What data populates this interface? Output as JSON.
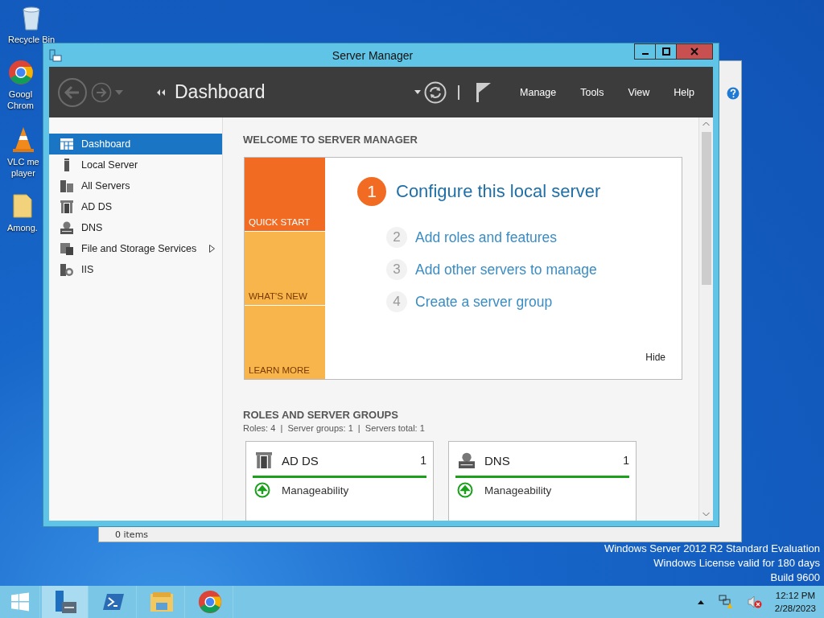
{
  "desktop": {
    "icons": [
      {
        "kind": "bin",
        "lines": [
          "Recycle Bin"
        ]
      },
      {
        "kind": "chrome",
        "lines": [
          "Googl",
          "Chrom"
        ]
      },
      {
        "kind": "vlc",
        "lines": [
          "VLC me",
          "player"
        ]
      },
      {
        "kind": "folder",
        "lines": [
          "Among."
        ]
      }
    ],
    "watermark": [
      "Windows Server 2012 R2 Standard Evaluation",
      "Windows License valid for 180 days",
      "Build 9600"
    ]
  },
  "back_window": {
    "status": "0 items"
  },
  "window": {
    "title": "Server Manager",
    "breadcrumb": "Dashboard",
    "menu": [
      "Manage",
      "Tools",
      "View",
      "Help"
    ],
    "sidebar": [
      {
        "kind": "dashboard",
        "label": "Dashboard",
        "selected": true,
        "submenu": false
      },
      {
        "kind": "server",
        "label": "Local Server",
        "selected": false,
        "submenu": false
      },
      {
        "kind": "servers",
        "label": "All Servers",
        "selected": false,
        "submenu": false
      },
      {
        "kind": "adds",
        "label": "AD DS",
        "selected": false,
        "submenu": false
      },
      {
        "kind": "dns",
        "label": "DNS",
        "selected": false,
        "submenu": false
      },
      {
        "kind": "storage",
        "label": "File and Storage Services",
        "selected": false,
        "submenu": true
      },
      {
        "kind": "iis",
        "label": "IIS",
        "selected": false,
        "submenu": false
      }
    ],
    "welcome": {
      "heading": "WELCOME TO SERVER MANAGER",
      "tiles": [
        {
          "label": "QUICK START",
          "selected": true
        },
        {
          "label": "WHAT'S NEW",
          "selected": false
        },
        {
          "label": "LEARN MORE",
          "selected": false
        }
      ],
      "steps": [
        {
          "number": "1",
          "label": "Configure this local server",
          "primary": true
        },
        {
          "number": "2",
          "label": "Add roles and features",
          "primary": false
        },
        {
          "number": "3",
          "label": "Add other servers to manage",
          "primary": false
        },
        {
          "number": "4",
          "label": "Create a server group",
          "primary": false
        }
      ],
      "hide": "Hide"
    },
    "roles": {
      "heading": "ROLES AND SERVER GROUPS",
      "stats": "Roles: 4  |  Server groups: 1  |  Servers total: 1",
      "cards": [
        {
          "kind": "adds",
          "title": "AD DS",
          "count": "1",
          "status": "Manageability"
        },
        {
          "kind": "dns",
          "title": "DNS",
          "count": "1",
          "status": "Manageability"
        }
      ]
    }
  },
  "taskbar": {
    "apps": [
      {
        "kind": "server-manager",
        "selected": true
      },
      {
        "kind": "powershell",
        "selected": false
      },
      {
        "kind": "explorer",
        "selected": false
      },
      {
        "kind": "chrome",
        "selected": false
      }
    ],
    "time": "12:12 PM",
    "date": "2/28/2023"
  }
}
